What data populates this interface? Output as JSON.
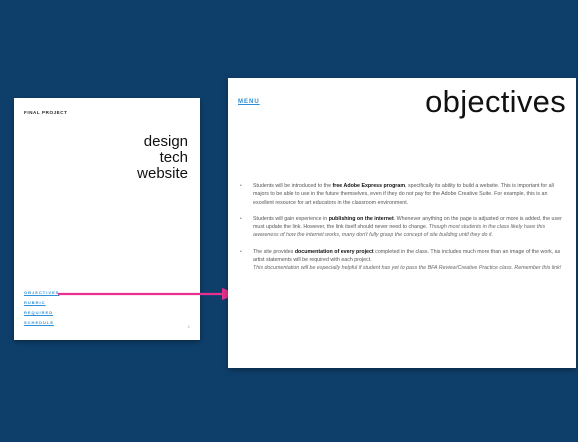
{
  "left_page": {
    "label": "FINAL PROJECT",
    "title_lines": [
      "design",
      "tech",
      "website"
    ],
    "links": [
      "OBJECTIVES",
      "RUBRIC",
      "REQUIRED",
      "SCHEDULE"
    ],
    "page_number": "1"
  },
  "right_page": {
    "menu_label": "MENU",
    "title": "objectives",
    "bullets": [
      {
        "pre": "Students will be introduced to the ",
        "bold": "free Adobe Express program",
        "post": ", specifically its ability to build a website. This is important for all majors to be able to use in the future themselves, even if they do not pay for the Adobe Creative Suite. For example, this is an excellent resource for art educators in the classroom environment.",
        "italic": ""
      },
      {
        "pre": "Students will gain experience in ",
        "bold": "publishing on the internet",
        "post": ". Whenever anything on the page is adjusted or more is added, the user must update the link. However, the link itself should never need to change. ",
        "italic": "Though most students in the class likely have this awareness of how the internet works, many don't fully grasp the concept of site building until they do it."
      },
      {
        "pre": "The site provides ",
        "bold": "documentation of every project",
        "post": " completed in the class. This includes much more than an image of the work, as artist statements will be required with each project.",
        "italic": "This documentation will be especially helpful if student has yet to pass the BFA Review/Creative Practice class. Remember this link!"
      }
    ]
  },
  "colors": {
    "background": "#0e3f6b",
    "link": "#2f8fd6",
    "arrow": "#e8308f"
  }
}
